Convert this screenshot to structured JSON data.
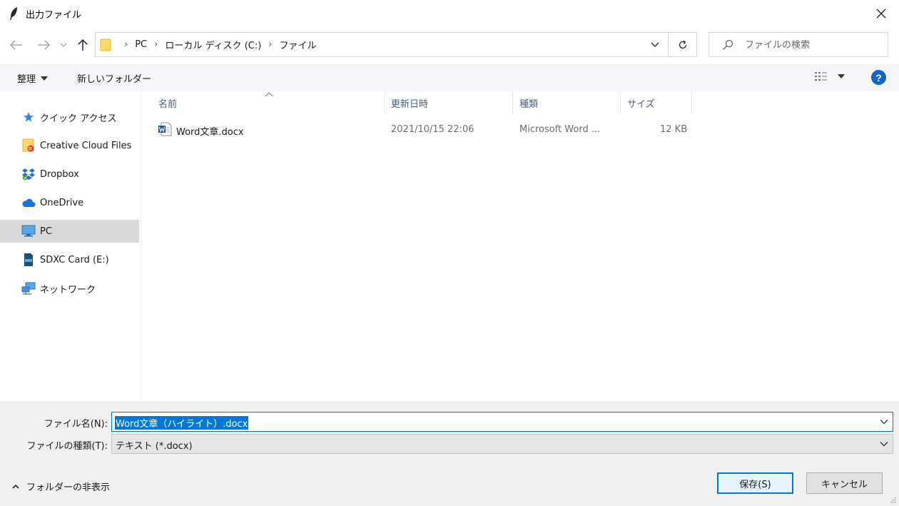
{
  "window": {
    "title": "出力ファイル"
  },
  "breadcrumbs": [
    "PC",
    "ローカル ディスク (C:)",
    "ファイル"
  ],
  "search": {
    "placeholder": "ファイルの検索"
  },
  "toolbar": {
    "organize_label": "整理",
    "new_folder_label": "新しいフォルダー"
  },
  "sidebar": {
    "items": [
      {
        "label": "クイック アクセス",
        "icon": "star-icon"
      },
      {
        "label": "Creative Cloud Files",
        "icon": "creative-cloud-folder-icon"
      },
      {
        "label": "Dropbox",
        "icon": "dropbox-icon"
      },
      {
        "label": "OneDrive",
        "icon": "cloud-icon"
      },
      {
        "label": "PC",
        "icon": "computer-icon",
        "selected": true
      },
      {
        "label": "SDXC Card (E:)",
        "icon": "sd-card-icon"
      },
      {
        "label": "ネットワーク",
        "icon": "network-icon"
      }
    ]
  },
  "columns": {
    "name": "名前",
    "date": "更新日時",
    "type": "種類",
    "size": "サイズ"
  },
  "files": [
    {
      "name": "Word文章.docx",
      "date": "2021/10/15 22:06",
      "type": "Microsoft Word ...",
      "size": "12 KB"
    }
  ],
  "form": {
    "filename_label": "ファイル名(N):",
    "filename_value": "Word文章（ハイライト）.docx",
    "filetype_label": "ファイルの種類(T):",
    "filetype_value": "テキスト (*.docx)"
  },
  "footer": {
    "hide_folders_label": "フォルダーの非表示",
    "save_label": "保存(S)",
    "cancel_label": "キャンセル"
  },
  "colors": {
    "accent": "#0078d7",
    "help": "#1565c0",
    "selected_nav": "#d9d9d9",
    "header_text": "#4c607a"
  }
}
